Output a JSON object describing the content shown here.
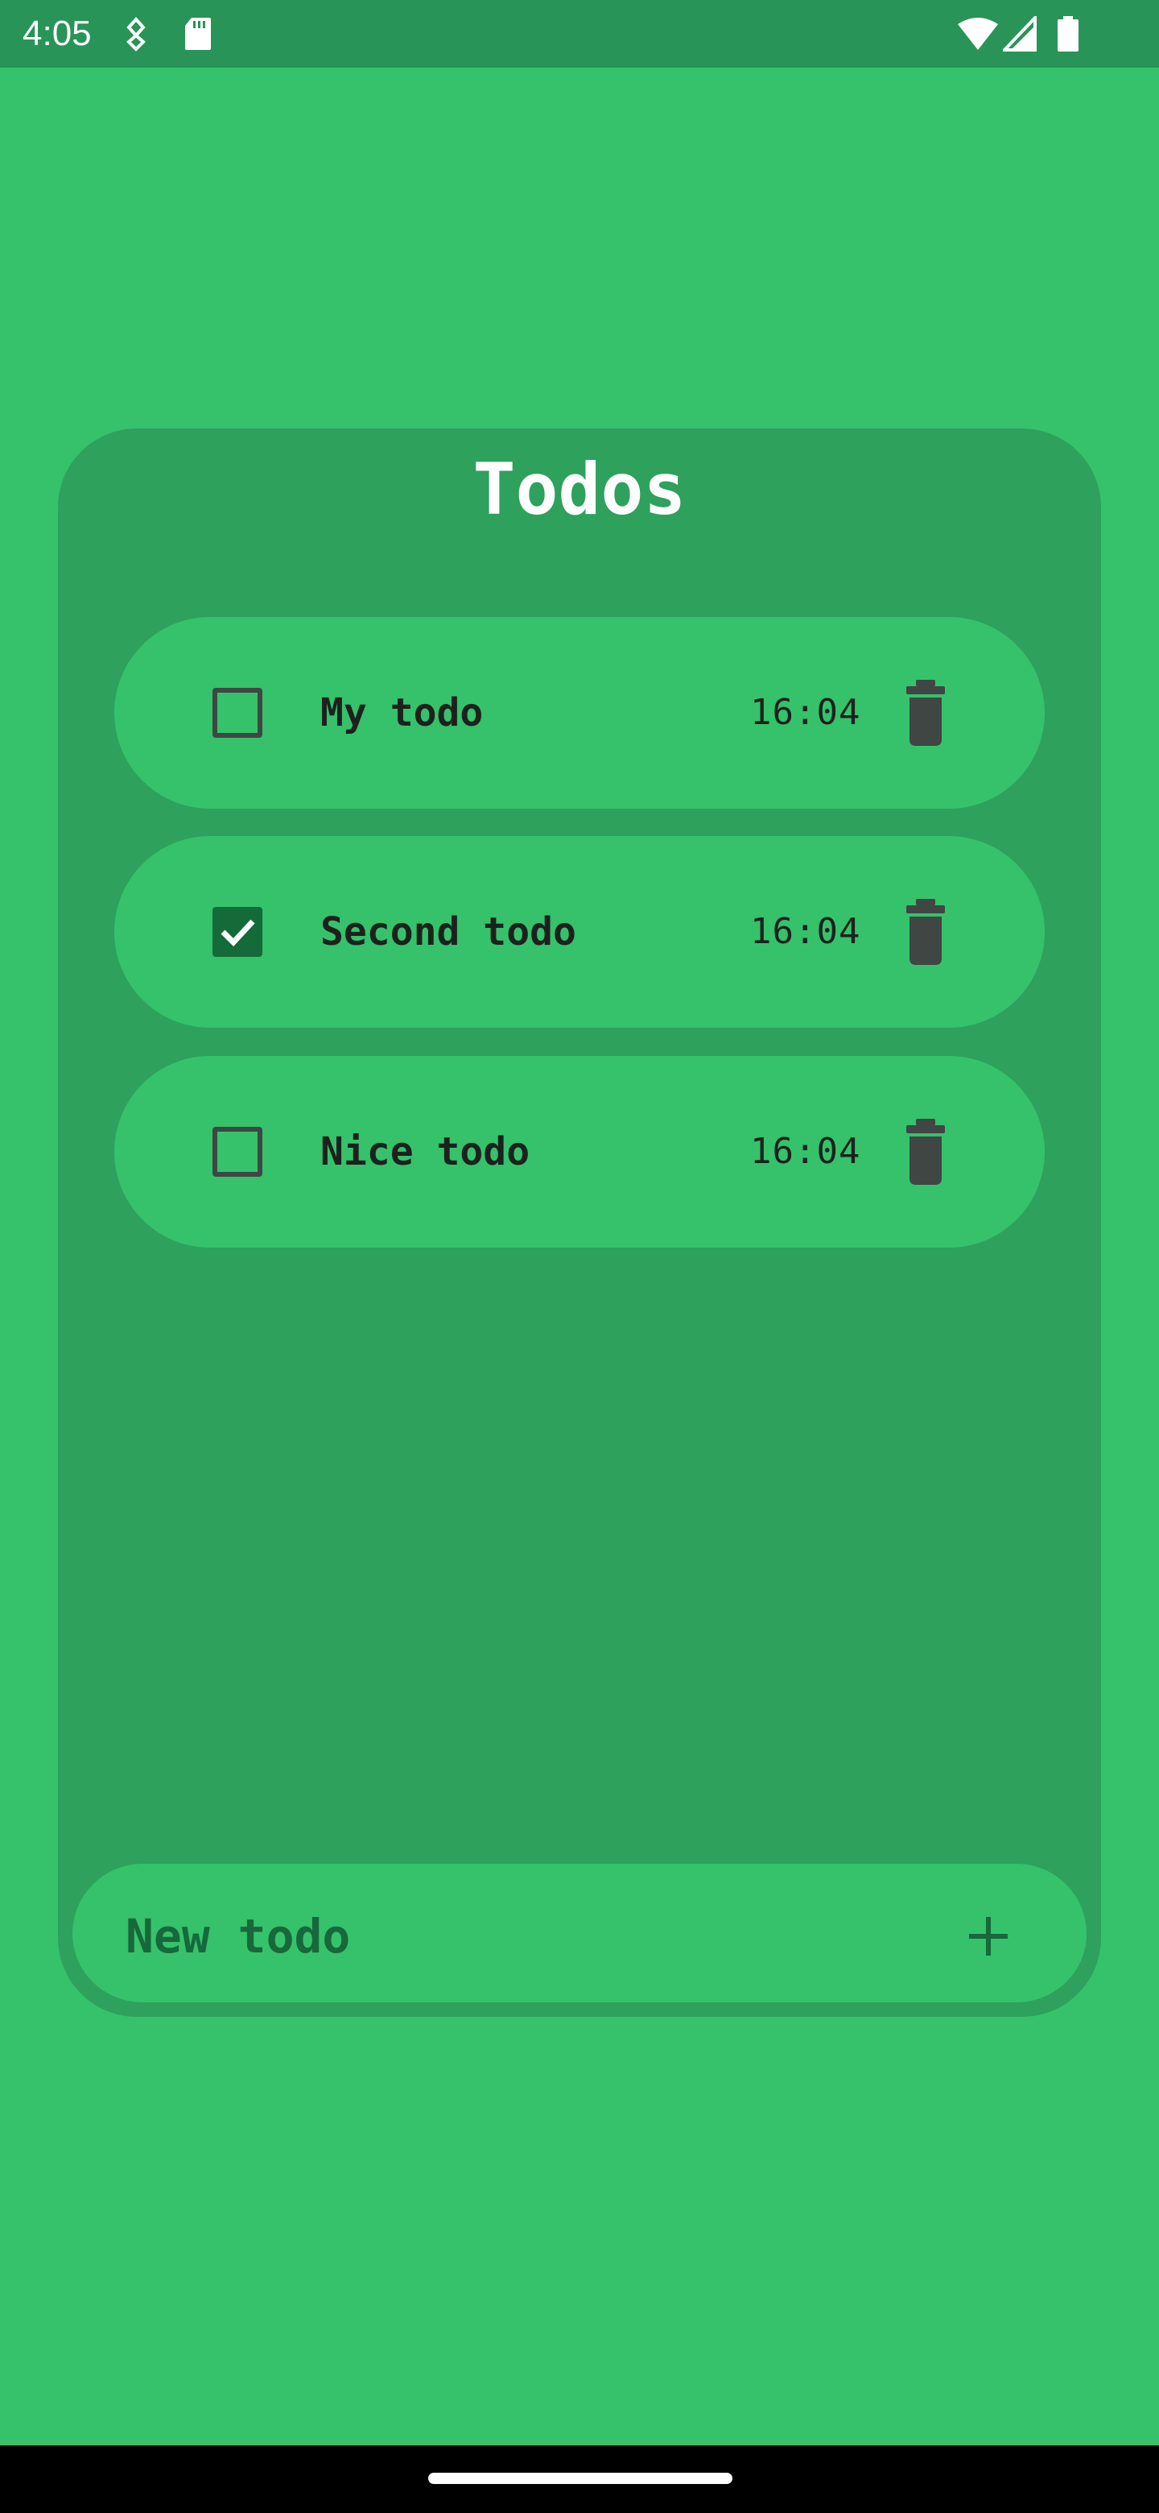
{
  "status_bar": {
    "time": "4:05",
    "left_icons": [
      "location-icon",
      "sd-card-icon"
    ],
    "right_icons": [
      "wifi-icon",
      "signal-icon",
      "battery-icon"
    ]
  },
  "app": {
    "title": "Todos",
    "todos": [
      {
        "label": "My todo",
        "time": "16:04",
        "checked": false
      },
      {
        "label": "Second todo",
        "time": "16:04",
        "checked": true
      },
      {
        "label": "Nice todo",
        "time": "16:04",
        "checked": false
      }
    ],
    "new_todo": {
      "placeholder": "New todo",
      "value": ""
    }
  },
  "colors": {
    "background": "#35c26b",
    "status_bar": "#289457",
    "card": "#2ea15c",
    "checked_box": "#156a3a",
    "accent_text": "#17683a",
    "icon_dark": "#3f4643"
  }
}
